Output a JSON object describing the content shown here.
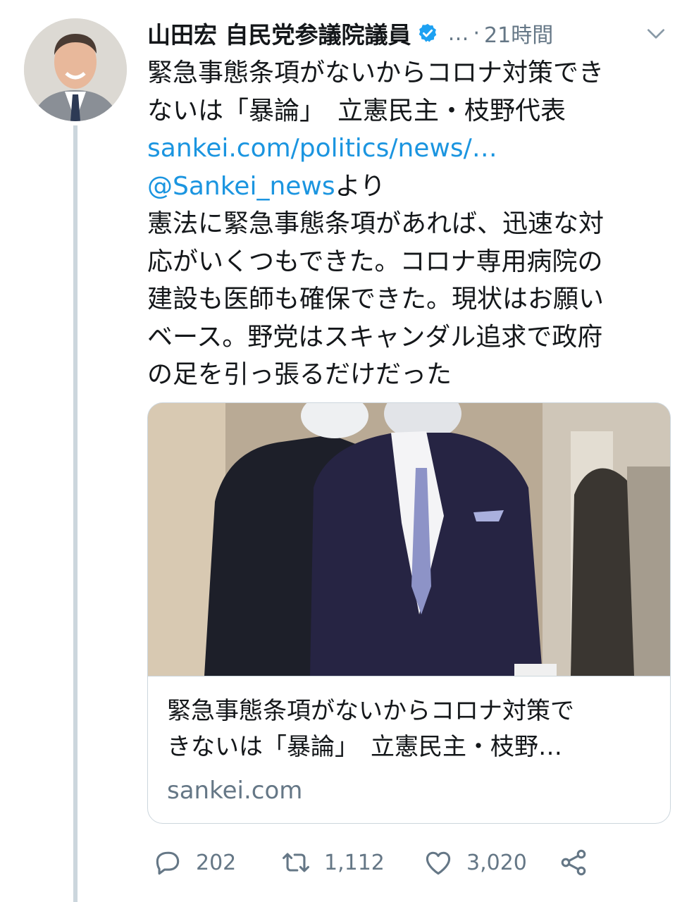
{
  "author": {
    "name": "山田宏 自民党参議院議員",
    "handle": "…",
    "separator": "·",
    "time": "21時間"
  },
  "tweet": {
    "lines": [
      "緊急事態条項がないからコロナ対策でき",
      "ないは「暴論」　立憲民主・枝野代表"
    ],
    "link": "sankei.com/politics/news/…",
    "mention": "@Sankei_news",
    "mention_suffix": "より",
    "body_lines": [
      "憲法に緊急事態条項があれば、迅速な対",
      "応がいくつもできた。コロナ専用病院の",
      "建設も医師も確保できた。現状はお願い",
      "ベース。野党はスキャンダル追求で政府",
      "の足を引っ張るだけだった"
    ]
  },
  "card": {
    "title_lines": [
      "緊急事態条項がないからコロナ対策で",
      "きないは「暴論」　立憲民主・枝野…"
    ],
    "domain": "sankei.com"
  },
  "actions": {
    "reply_count": "202",
    "retweet_count": "1,112",
    "like_count": "3,020"
  },
  "icons": {
    "verified": "verified-badge-icon",
    "caret": "chevron-down-icon",
    "reply": "reply-icon",
    "retweet": "retweet-icon",
    "like": "heart-icon",
    "share": "share-icon"
  },
  "colors": {
    "link": "#1b95e0",
    "muted": "#657786",
    "border": "#ccd6dd",
    "verified": "#1da1f2"
  }
}
